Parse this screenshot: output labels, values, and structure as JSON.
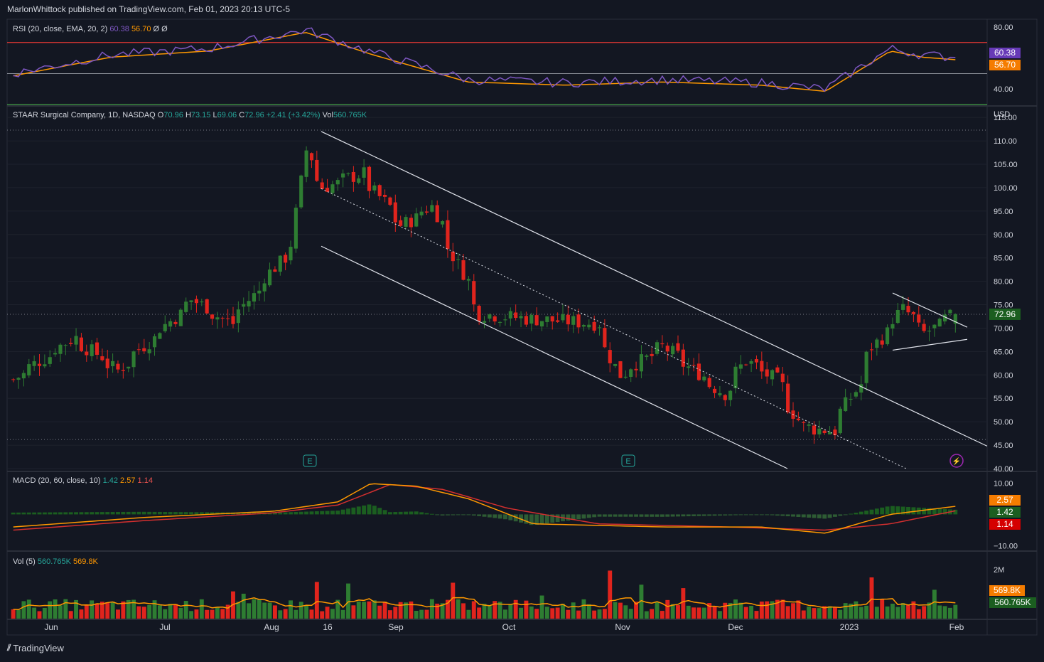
{
  "header": {
    "published": "MarlonWhittock published on TradingView.com, Feb 01, 2023 20:13 UTC-5"
  },
  "footer": {
    "brand": "TradingView",
    "logo": "tradingview-logo-icon"
  },
  "colors": {
    "bg": "#131722",
    "up": "#26a69a",
    "down": "#ef5350",
    "green": "#2e7d32",
    "red": "#e0241d",
    "rsi": "#7e57c2",
    "orange": "#ff9800",
    "grid": "#2a2e39"
  },
  "rsi": {
    "legend": "RSI (20, close, EMA, 20, 2)",
    "v1": "60.38",
    "v2": "56.70",
    "v3": "Ø",
    "v4": "Ø",
    "ticks": [
      "80.00",
      "40.00"
    ],
    "badge_rsi": "60.38",
    "badge_ma": "56.70"
  },
  "price": {
    "legend_name": "STAAR Surgical Company, 1D, NASDAQ",
    "o_label": "O",
    "o": "70.96",
    "h_label": "H",
    "h": "73.15",
    "l_label": "L",
    "l": "69.06",
    "c_label": "C",
    "c": "72.96",
    "chg": "+2.41 (+3.42%)",
    "vol_label": "Vol",
    "vol": "560.765K",
    "currency": "USD",
    "ticks": [
      "115.00",
      "110.00",
      "105.00",
      "100.00",
      "95.00",
      "90.00",
      "85.00",
      "80.00",
      "75.00",
      "70.00",
      "65.00",
      "60.00",
      "55.00",
      "50.00",
      "45.00",
      "40.00"
    ],
    "last_badge": "72.96",
    "earnings_marker": "E"
  },
  "macd": {
    "legend": "MACD (20, 60, close, 10)",
    "v1": "1.42",
    "v2": "2.57",
    "v3": "1.14",
    "ticks": [
      "10.00",
      "−10.00"
    ],
    "badge_signal": "2.57",
    "badge_macd": "1.42",
    "badge_hist": "1.14"
  },
  "volume": {
    "legend": "Vol (5)",
    "v1": "560.765K",
    "v2": "569.8K",
    "ticks": [
      "2M"
    ],
    "badge_ma": "569.8K",
    "badge_vol": "560.765K"
  },
  "time_axis": [
    "Jun",
    "Jul",
    "Aug",
    "16",
    "Sep",
    "Oct",
    "Nov",
    "Dec",
    "2023",
    "Feb"
  ],
  "chart_data": {
    "type": "candlestick",
    "title": "STAAR Surgical Company, 1D, NASDAQ",
    "x_range": [
      "2022-05-25",
      "2023-02-01"
    ],
    "price_ylim": [
      40,
      117
    ],
    "ohlc_last": {
      "open": 70.96,
      "high": 73.15,
      "low": 69.06,
      "close": 72.96
    },
    "close_keypoints": [
      {
        "date": "2022-05-25",
        "close": 59
      },
      {
        "date": "2022-06-10",
        "close": 68
      },
      {
        "date": "2022-06-22",
        "close": 61
      },
      {
        "date": "2022-07-12",
        "close": 76
      },
      {
        "date": "2022-07-22",
        "close": 71
      },
      {
        "date": "2022-08-08",
        "close": 88
      },
      {
        "date": "2022-08-11",
        "close": 108
      },
      {
        "date": "2022-08-16",
        "close": 100
      },
      {
        "date": "2022-08-26",
        "close": 103
      },
      {
        "date": "2022-09-06",
        "close": 92
      },
      {
        "date": "2022-09-14",
        "close": 96
      },
      {
        "date": "2022-09-27",
        "close": 73
      },
      {
        "date": "2022-10-10",
        "close": 72
      },
      {
        "date": "2022-10-28",
        "close": 71
      },
      {
        "date": "2022-11-03",
        "close": 60
      },
      {
        "date": "2022-11-15",
        "close": 66
      },
      {
        "date": "2022-12-01",
        "close": 56
      },
      {
        "date": "2022-12-07",
        "close": 63
      },
      {
        "date": "2022-12-15",
        "close": 59
      },
      {
        "date": "2022-12-22",
        "close": 49
      },
      {
        "date": "2022-12-30",
        "close": 48
      },
      {
        "date": "2023-01-06",
        "close": 58
      },
      {
        "date": "2023-01-10",
        "close": 66
      },
      {
        "date": "2023-01-18",
        "close": 74
      },
      {
        "date": "2023-01-24",
        "close": 69
      },
      {
        "date": "2023-02-01",
        "close": 72.96
      }
    ],
    "rsi_keypoints": [
      [
        0,
        50
      ],
      [
        15,
        62
      ],
      [
        30,
        66
      ],
      [
        45,
        78
      ],
      [
        55,
        64
      ],
      [
        70,
        46
      ],
      [
        85,
        44
      ],
      [
        100,
        46
      ],
      [
        115,
        44
      ],
      [
        125,
        40
      ],
      [
        135,
        66
      ],
      [
        140,
        62
      ],
      [
        145,
        60.38
      ]
    ],
    "rsi_ylim": [
      30,
      85
    ],
    "rsi_levels": [
      70,
      30,
      50
    ],
    "macd_ylim": [
      -11,
      13
    ],
    "macd_keypoints": [
      [
        0,
        -4
      ],
      [
        20,
        -1
      ],
      [
        40,
        1
      ],
      [
        50,
        4
      ],
      [
        55,
        9.8
      ],
      [
        62,
        9
      ],
      [
        70,
        5
      ],
      [
        80,
        -3
      ],
      [
        100,
        -4
      ],
      [
        115,
        -4
      ],
      [
        125,
        -6
      ],
      [
        135,
        0
      ],
      [
        145,
        2.57
      ]
    ],
    "signal_keypoints": [
      [
        0,
        -5
      ],
      [
        20,
        -2
      ],
      [
        40,
        0.5
      ],
      [
        50,
        3
      ],
      [
        58,
        9.5
      ],
      [
        66,
        8
      ],
      [
        76,
        2
      ],
      [
        90,
        -3
      ],
      [
        110,
        -4
      ],
      [
        125,
        -5
      ],
      [
        135,
        -3
      ],
      [
        145,
        1.14
      ]
    ],
    "volume_ylim": [
      0,
      2400000
    ],
    "volume_last": 560765,
    "volume_ma_last": 569800
  }
}
